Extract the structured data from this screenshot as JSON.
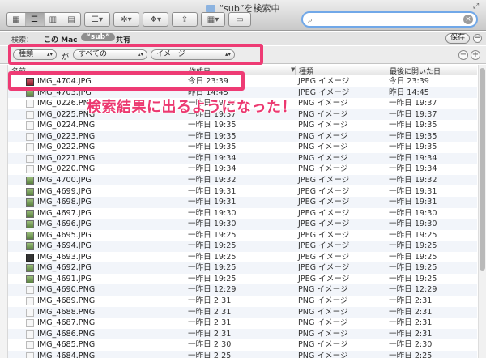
{
  "window": {
    "title": "“sub”を検索中"
  },
  "search": {
    "value": ""
  },
  "scope": {
    "label": "検索：",
    "this_mac": "この Mac",
    "selected": "“sub”",
    "shared": "共有",
    "save": "保存"
  },
  "criteria": {
    "attribute": "種類",
    "ga": "が",
    "operator": "すべての",
    "value": "イメージ"
  },
  "columns": {
    "name": "名前",
    "date": "作成日",
    "kind": "種類",
    "last_opened": "最後に開いた日"
  },
  "annotation": "検索結果に出るようになった！",
  "files": [
    {
      "name": "IMG_4704.JPG",
      "date": "今日 23:39",
      "kind": "JPEG イメージ",
      "last_opened": "今日 23:39",
      "icon": "pink"
    },
    {
      "name": "IMG_4703.JPG",
      "date": "昨日 14:45",
      "kind": "JPEG イメージ",
      "last_opened": "昨日 14:45",
      "icon": "jpg"
    },
    {
      "name": "IMG_0226.PNG",
      "date": "一昨日 19:37",
      "kind": "PNG イメージ",
      "last_opened": "一昨日 19:37",
      "icon": "png"
    },
    {
      "name": "IMG_0225.PNG",
      "date": "一昨日 19:37",
      "kind": "PNG イメージ",
      "last_opened": "一昨日 19:37",
      "icon": "png"
    },
    {
      "name": "IMG_0224.PNG",
      "date": "一昨日 19:35",
      "kind": "PNG イメージ",
      "last_opened": "一昨日 19:35",
      "icon": "png"
    },
    {
      "name": "IMG_0223.PNG",
      "date": "一昨日 19:35",
      "kind": "PNG イメージ",
      "last_opened": "一昨日 19:35",
      "icon": "png"
    },
    {
      "name": "IMG_0222.PNG",
      "date": "一昨日 19:35",
      "kind": "PNG イメージ",
      "last_opened": "一昨日 19:35",
      "icon": "png"
    },
    {
      "name": "IMG_0221.PNG",
      "date": "一昨日 19:34",
      "kind": "PNG イメージ",
      "last_opened": "一昨日 19:34",
      "icon": "png"
    },
    {
      "name": "IMG_0220.PNG",
      "date": "一昨日 19:34",
      "kind": "PNG イメージ",
      "last_opened": "一昨日 19:34",
      "icon": "png"
    },
    {
      "name": "IMG_4700.JPG",
      "date": "一昨日 19:32",
      "kind": "JPEG イメージ",
      "last_opened": "一昨日 19:32",
      "icon": "jpg"
    },
    {
      "name": "IMG_4699.JPG",
      "date": "一昨日 19:31",
      "kind": "JPEG イメージ",
      "last_opened": "一昨日 19:31",
      "icon": "jpg"
    },
    {
      "name": "IMG_4698.JPG",
      "date": "一昨日 19:31",
      "kind": "JPEG イメージ",
      "last_opened": "一昨日 19:31",
      "icon": "jpg"
    },
    {
      "name": "IMG_4697.JPG",
      "date": "一昨日 19:30",
      "kind": "JPEG イメージ",
      "last_opened": "一昨日 19:30",
      "icon": "jpg"
    },
    {
      "name": "IMG_4696.JPG",
      "date": "一昨日 19:30",
      "kind": "JPEG イメージ",
      "last_opened": "一昨日 19:30",
      "icon": "jpg"
    },
    {
      "name": "IMG_4695.JPG",
      "date": "一昨日 19:25",
      "kind": "JPEG イメージ",
      "last_opened": "一昨日 19:25",
      "icon": "jpg"
    },
    {
      "name": "IMG_4694.JPG",
      "date": "一昨日 19:25",
      "kind": "JPEG イメージ",
      "last_opened": "一昨日 19:25",
      "icon": "jpg"
    },
    {
      "name": "IMG_4693.JPG",
      "date": "一昨日 19:25",
      "kind": "JPEG イメージ",
      "last_opened": "一昨日 19:25",
      "icon": "dark"
    },
    {
      "name": "IMG_4692.JPG",
      "date": "一昨日 19:25",
      "kind": "JPEG イメージ",
      "last_opened": "一昨日 19:25",
      "icon": "jpg"
    },
    {
      "name": "IMG_4691.JPG",
      "date": "一昨日 19:25",
      "kind": "JPEG イメージ",
      "last_opened": "一昨日 19:25",
      "icon": "jpg"
    },
    {
      "name": "IMG_4690.PNG",
      "date": "一昨日 12:29",
      "kind": "PNG イメージ",
      "last_opened": "一昨日 12:29",
      "icon": "png"
    },
    {
      "name": "IMG_4689.PNG",
      "date": "一昨日 2:31",
      "kind": "PNG イメージ",
      "last_opened": "一昨日 2:31",
      "icon": "png"
    },
    {
      "name": "IMG_4688.PNG",
      "date": "一昨日 2:31",
      "kind": "PNG イメージ",
      "last_opened": "一昨日 2:31",
      "icon": "png"
    },
    {
      "name": "IMG_4687.PNG",
      "date": "一昨日 2:31",
      "kind": "PNG イメージ",
      "last_opened": "一昨日 2:31",
      "icon": "png"
    },
    {
      "name": "IMG_4686.PNG",
      "date": "一昨日 2:31",
      "kind": "PNG イメージ",
      "last_opened": "一昨日 2:31",
      "icon": "png"
    },
    {
      "name": "IMG_4685.PNG",
      "date": "一昨日 2:30",
      "kind": "PNG イメージ",
      "last_opened": "一昨日 2:30",
      "icon": "png"
    },
    {
      "name": "IMG_4684.PNG",
      "date": "一昨日 2:25",
      "kind": "PNG イメージ",
      "last_opened": "一昨日 2:25",
      "icon": "png"
    }
  ]
}
